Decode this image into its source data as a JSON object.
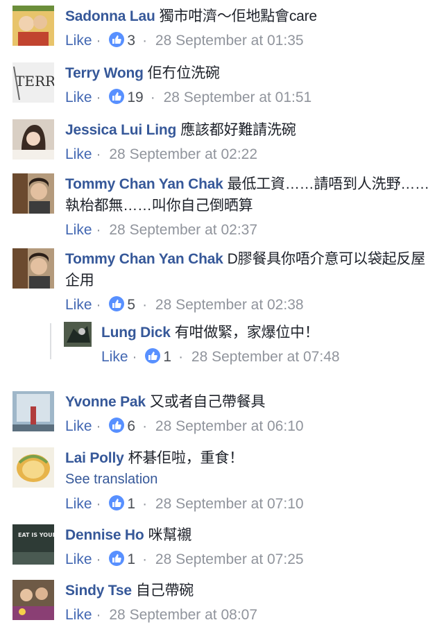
{
  "comments": [
    {
      "name": "Sadonna Lau",
      "text": "獨市咁濟～佢地點會care",
      "like_label": "Like",
      "likes": "3",
      "time": "28 September at 01:35"
    },
    {
      "name": "Terry Wong",
      "text": "佢冇位洗碗",
      "like_label": "Like",
      "likes": "19",
      "time": "28 September at 01:51"
    },
    {
      "name": "Jessica Lui Ling",
      "text": "應該都好難請洗碗",
      "like_label": "Like",
      "likes": "",
      "time": "28 September at 02:22"
    },
    {
      "name": "Tommy Chan Yan Chak",
      "text": "最低工資……請唔到人洗野……執枱都無……叫你自己倒晒算",
      "like_label": "Like",
      "likes": "",
      "time": "28 September at 02:37"
    },
    {
      "name": "Tommy Chan Yan Chak",
      "text": "D膠餐具你唔介意可以袋起反屋企用",
      "like_label": "Like",
      "likes": "5",
      "time": "28 September at 02:38"
    },
    {
      "name": "Lung Dick",
      "text": "有咁做緊，家爆位中！",
      "like_label": "Like",
      "likes": "1",
      "time": "28 September at 07:48"
    },
    {
      "name": "Yvonne Pak",
      "text": "又或者自己帶餐具",
      "like_label": "Like",
      "likes": "6",
      "time": "28 September at 06:10"
    },
    {
      "name": "Lai Polly",
      "text": "杯碁佢啦，重食！",
      "see_translation": "See translation",
      "like_label": "Like",
      "likes": "1",
      "time": "28 September at 07:10"
    },
    {
      "name": "Dennise Ho",
      "text": "咪幫襯",
      "like_label": "Like",
      "likes": "1",
      "time": "28 September at 07:25"
    },
    {
      "name": "Sindy Tse",
      "text": "自己帶碗",
      "like_label": "Like",
      "likes": "",
      "time": "28 September at 08:07"
    }
  ],
  "avatar_texts": {
    "terry": "TERRY",
    "dennise": "EAT IS YOUR LIFE"
  },
  "colors": {
    "name": "#365899",
    "like": "#4267b2",
    "meta": "#90949c",
    "like_badge": "#5890ff"
  }
}
